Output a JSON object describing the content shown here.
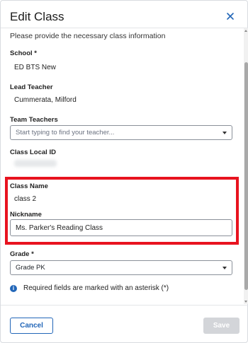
{
  "dialog": {
    "title": "Edit Class",
    "close_icon": "close-icon",
    "intro": "Please provide the necessary class information"
  },
  "fields": {
    "school": {
      "label": "School *",
      "value": "ED BTS New"
    },
    "lead_teacher": {
      "label": "Lead Teacher",
      "value": "Cummerata, Milford"
    },
    "team_teachers": {
      "label": "Team Teachers",
      "placeholder": "Start typing to find your teacher..."
    },
    "class_local_id": {
      "label": "Class Local ID"
    },
    "class_name": {
      "label": "Class Name",
      "value": "class 2"
    },
    "nickname": {
      "label": "Nickname",
      "value": "Ms. Parker's Reading Class"
    },
    "grade": {
      "label": "Grade *",
      "value": "Grade PK"
    }
  },
  "info": {
    "icon": "info-icon",
    "text": "Required fields are marked with an asterisk (*)"
  },
  "footer": {
    "cancel_label": "Cancel",
    "save_label": "Save"
  },
  "colors": {
    "accent": "#2266b8",
    "highlight": "#e8131f",
    "disabled": "#d3d5d9"
  }
}
